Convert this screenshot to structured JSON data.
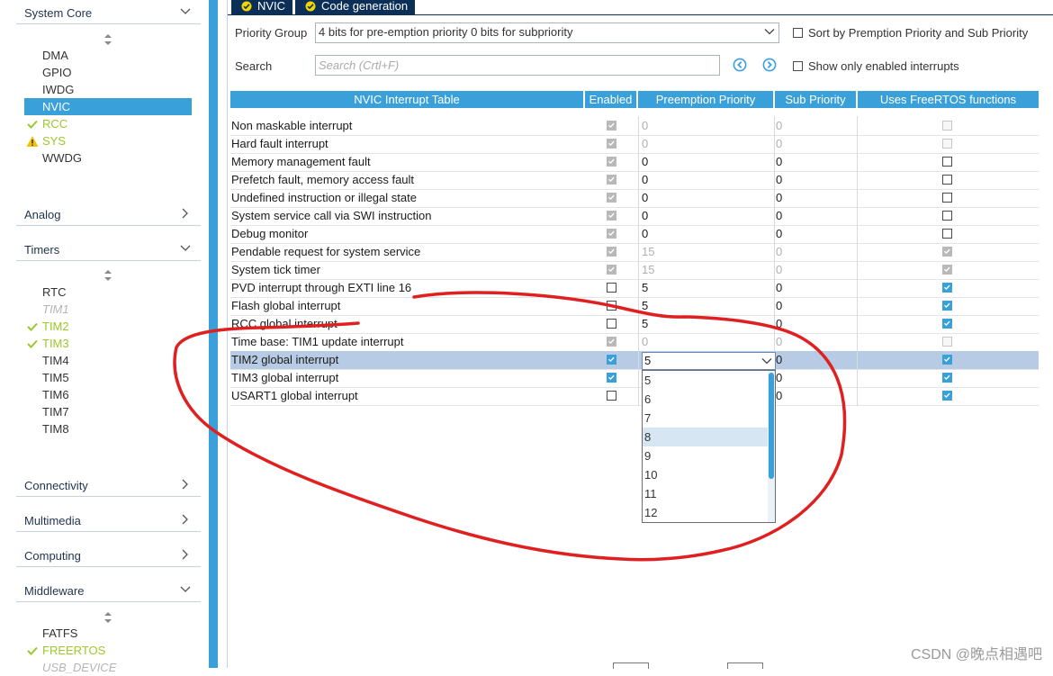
{
  "colors": {
    "accent": "#3aa0d9",
    "nav_dark": "#0b2f57",
    "enabled_green": "#9bc82a",
    "warning": "#f2c200",
    "annotation_red": "#e02020"
  },
  "sidebar": {
    "system_core": {
      "label": "System Core",
      "items": [
        {
          "label": "DMA",
          "state": "normal"
        },
        {
          "label": "GPIO",
          "state": "normal"
        },
        {
          "label": "IWDG",
          "state": "normal"
        },
        {
          "label": "NVIC",
          "state": "selected"
        },
        {
          "label": "RCC",
          "state": "ok"
        },
        {
          "label": "SYS",
          "state": "warning"
        },
        {
          "label": "WWDG",
          "state": "normal"
        }
      ]
    },
    "analog": {
      "label": "Analog"
    },
    "timers": {
      "label": "Timers",
      "items": [
        {
          "label": "RTC",
          "state": "normal"
        },
        {
          "label": "TIM1",
          "state": "disabled"
        },
        {
          "label": "TIM2",
          "state": "ok"
        },
        {
          "label": "TIM3",
          "state": "ok"
        },
        {
          "label": "TIM4",
          "state": "normal"
        },
        {
          "label": "TIM5",
          "state": "normal"
        },
        {
          "label": "TIM6",
          "state": "normal"
        },
        {
          "label": "TIM7",
          "state": "normal"
        },
        {
          "label": "TIM8",
          "state": "normal"
        }
      ]
    },
    "connectivity": {
      "label": "Connectivity"
    },
    "multimedia": {
      "label": "Multimedia"
    },
    "computing": {
      "label": "Computing"
    },
    "middleware": {
      "label": "Middleware",
      "items": [
        {
          "label": "FATFS",
          "state": "normal"
        },
        {
          "label": "FREERTOS",
          "state": "ok"
        },
        {
          "label": "USB_DEVICE",
          "state": "disabled"
        }
      ]
    }
  },
  "tabs": [
    {
      "label": "NVIC"
    },
    {
      "label": "Code generation"
    }
  ],
  "toolbar": {
    "priority_group_label": "Priority Group",
    "priority_group_value": "4 bits for pre-emption priority 0 bits for subpriority",
    "sort_label": "Sort by Premption Priority and Sub Priority",
    "search_label": "Search",
    "search_placeholder": "Search (Crtl+F)",
    "show_enabled_label": "Show only enabled interrupts"
  },
  "table": {
    "headers": [
      "NVIC Interrupt Table",
      "Enabled",
      "Preemption Priority",
      "Sub Priority",
      "Uses FreeRTOS functions"
    ],
    "rows": [
      {
        "name": "Non maskable interrupt",
        "enabled": "checked-gray",
        "pre": "0",
        "sub": "0",
        "freertos": "disabled",
        "grey": true
      },
      {
        "name": "Hard fault interrupt",
        "enabled": "checked-gray",
        "pre": "0",
        "sub": "0",
        "freertos": "disabled",
        "grey": true
      },
      {
        "name": "Memory management fault",
        "enabled": "checked-gray",
        "pre": "0",
        "sub": "0",
        "freertos": "unchecked",
        "grey": false
      },
      {
        "name": "Prefetch fault, memory access fault",
        "enabled": "checked-gray",
        "pre": "0",
        "sub": "0",
        "freertos": "unchecked",
        "grey": false
      },
      {
        "name": "Undefined instruction or illegal state",
        "enabled": "checked-gray",
        "pre": "0",
        "sub": "0",
        "freertos": "unchecked",
        "grey": false
      },
      {
        "name": "System service call via SWI instruction",
        "enabled": "checked-gray",
        "pre": "0",
        "sub": "0",
        "freertos": "unchecked",
        "grey": false
      },
      {
        "name": "Debug monitor",
        "enabled": "checked-gray",
        "pre": "0",
        "sub": "0",
        "freertos": "unchecked",
        "grey": false
      },
      {
        "name": "Pendable request for system service",
        "enabled": "checked-gray",
        "pre": "15",
        "sub": "0",
        "freertos": "checked-gray",
        "grey": true
      },
      {
        "name": "System tick timer",
        "enabled": "checked-gray",
        "pre": "15",
        "sub": "0",
        "freertos": "checked-gray",
        "grey": true
      },
      {
        "name": "PVD interrupt through EXTI line 16",
        "enabled": "unchecked",
        "pre": "5",
        "sub": "0",
        "freertos": "checked-blue",
        "grey": false
      },
      {
        "name": "Flash global interrupt",
        "enabled": "unchecked",
        "pre": "5",
        "sub": "0",
        "freertos": "checked-blue",
        "grey": false
      },
      {
        "name": "RCC global interrupt",
        "enabled": "unchecked",
        "pre": "5",
        "sub": "0",
        "freertos": "checked-blue",
        "grey": false
      },
      {
        "name": "Time base: TIM1 update interrupt",
        "enabled": "checked-gray",
        "pre": "0",
        "sub": "0",
        "freertos": "disabled",
        "grey": true
      },
      {
        "name": "TIM2 global interrupt",
        "enabled": "checked-blue",
        "pre": "5",
        "sub": "0",
        "freertos": "checked-blue",
        "grey": false,
        "selected": true
      },
      {
        "name": "TIM3 global interrupt",
        "enabled": "checked-blue",
        "pre": "",
        "sub": "0",
        "freertos": "checked-blue",
        "grey": false
      },
      {
        "name": "USART1 global interrupt",
        "enabled": "unchecked",
        "pre": "",
        "sub": "0",
        "freertos": "checked-blue",
        "grey": false
      }
    ]
  },
  "dropdown": {
    "value": "5",
    "options": [
      "5",
      "6",
      "7",
      "8",
      "9",
      "10",
      "11",
      "12"
    ],
    "highlighted": "8"
  },
  "watermark": "CSDN @晚点相遇吧"
}
